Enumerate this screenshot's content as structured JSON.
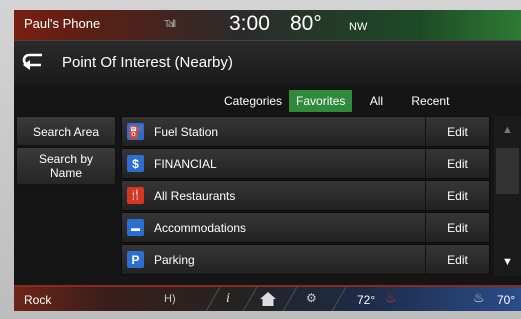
{
  "statusbar": {
    "phone_name": "Paul's Phone",
    "signal": "Tall",
    "time": "3:00",
    "outside_temp": "80°",
    "compass": "NW"
  },
  "header": {
    "title": "Point Of Interest (Nearby)"
  },
  "tabs": [
    {
      "label": "Categories",
      "active": false
    },
    {
      "label": "Favorites",
      "active": true
    },
    {
      "label": "All",
      "active": false
    },
    {
      "label": "Recent",
      "active": false
    }
  ],
  "sidebar": {
    "search_area": "Search Area",
    "search_by_name_1": "Search by",
    "search_by_name_2": "Name"
  },
  "list": {
    "items": [
      {
        "label": "Fuel Station",
        "icon": "fuel-pump-icon",
        "icon_glyph": "⛽",
        "icon_color": "#2d6fd1",
        "edit": "Edit"
      },
      {
        "label": "FINANCIAL",
        "icon": "dollar-icon",
        "icon_glyph": "$",
        "icon_color": "#2d6fd1",
        "edit": "Edit"
      },
      {
        "label": "All Restaurants",
        "icon": "fork-knife-icon",
        "icon_glyph": "🍴",
        "icon_color": "#d8351f",
        "edit": "Edit"
      },
      {
        "label": "Accommodations",
        "icon": "bed-icon",
        "icon_glyph": "▬",
        "icon_color": "#2d6fd1",
        "edit": "Edit"
      },
      {
        "label": "Parking",
        "icon": "parking-icon",
        "icon_glyph": "P",
        "icon_color": "#2d6fd1",
        "edit": "Edit"
      }
    ]
  },
  "scrollbar": {
    "up_glyph": "▲",
    "down_glyph": "▼"
  },
  "bottombar": {
    "source": "Rock",
    "hd": "H)",
    "info": "i",
    "settings": "⚙",
    "left_temp": "72°",
    "seat_left": "♨",
    "seat_right": "♨",
    "right_temp": "70°"
  },
  "colors": {
    "active_tab": "#2f8a3c",
    "accent_blue": "#2d6fd1",
    "accent_red": "#d8351f"
  }
}
